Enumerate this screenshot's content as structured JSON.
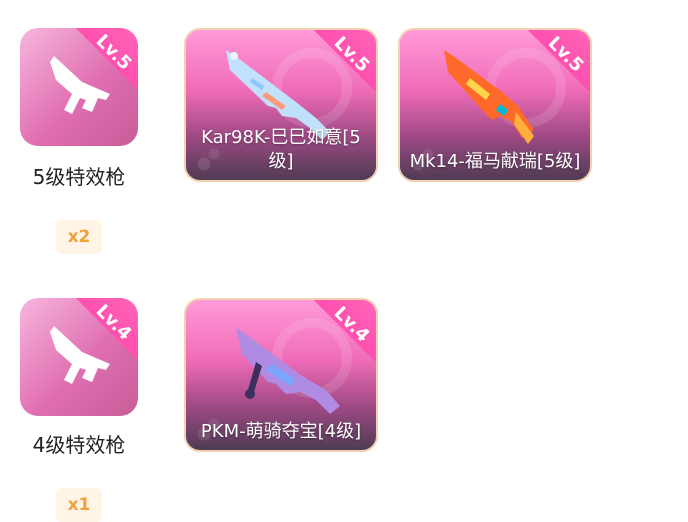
{
  "groups": [
    {
      "category": {
        "name": "5级特效枪",
        "level_badge": "Lv.5",
        "count_badge": "x2",
        "icon": "rifle-icon"
      },
      "skins": [
        {
          "name": "Kar98K-巳巳如意[5级]",
          "level_badge": "Lv.5",
          "weapon_icon": "sniper-rifle-icon"
        },
        {
          "name": "Mk14-福马献瑞[5级]",
          "level_badge": "Lv.5",
          "weapon_icon": "marksman-rifle-icon"
        }
      ]
    },
    {
      "category": {
        "name": "4级特效枪",
        "level_badge": "Lv.4",
        "count_badge": "x1",
        "icon": "rifle-icon"
      },
      "skins": [
        {
          "name": "PKM-萌骑夺宝[4级]",
          "level_badge": "Lv.4",
          "weapon_icon": "machine-gun-icon"
        }
      ]
    }
  ],
  "colors": {
    "tile_pink": "#e06fb1",
    "ribbon_pink": "#ff4fae",
    "badge_bg": "#fff4e5",
    "badge_text": "#f0a23a"
  }
}
